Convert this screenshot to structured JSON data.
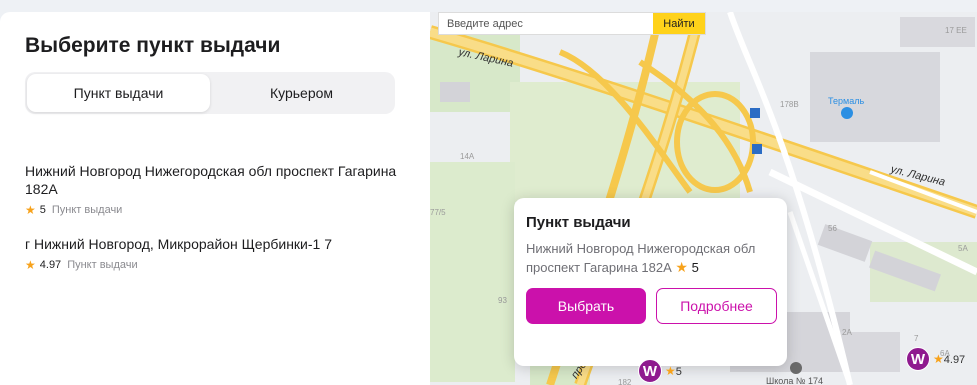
{
  "panel": {
    "title": "Выберите пункт выдачи",
    "tabs": [
      {
        "label": "Пункт выдачи",
        "active": true
      },
      {
        "label": "Курьером",
        "active": false
      }
    ]
  },
  "points": [
    {
      "address": "Нижний Новгород Нижегородская обл проспект Гагарина 182А",
      "rating": "5",
      "type": "Пункт выдачи"
    },
    {
      "address": "г Нижний Новгород, Микрорайон Щербинки-1 7",
      "rating": "4.97",
      "type": "Пункт выдачи"
    }
  ],
  "map": {
    "search": {
      "placeholder": "Введите адрес",
      "button": "Найти"
    },
    "streets": [
      "ул. Ларина",
      "ул. Ларина",
      "про"
    ],
    "places": {
      "thermal": "Термаль",
      "school": "Школа № 174"
    },
    "buildings": [
      "17 ЕЕ",
      "178В",
      "14А",
      "56",
      "5А",
      "93",
      "182",
      "2А",
      "7",
      "6А",
      "77/5"
    ],
    "popup": {
      "title": "Пункт выдачи",
      "address": "Нижний Новгород Нижегородская обл проспект Гагарина 182А",
      "rating": "5",
      "select_button": "Выбрать",
      "details_button": "Подробнее"
    },
    "markers": [
      {
        "letter": "W",
        "rating": "5"
      },
      {
        "letter": "W",
        "rating": "4.97"
      }
    ]
  },
  "colors": {
    "accent": "#cb11ab",
    "marker": "#8f1a8f",
    "star": "#f7a21b",
    "search_button": "#ffd21a"
  }
}
